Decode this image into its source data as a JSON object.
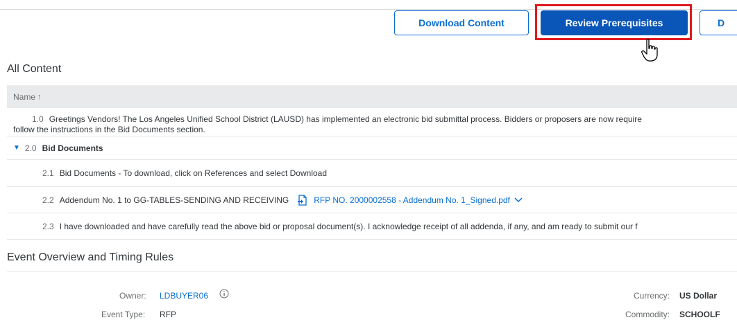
{
  "toolbar": {
    "download_label": "Download Content",
    "review_label": "Review Prerequisites",
    "partial_label": "D"
  },
  "all_content": {
    "title": "All Content",
    "header_name": "Name",
    "sort_indicator": "↑",
    "rows": [
      {
        "num": "1.0",
        "text": "Greetings Vendors! The Los Angeles Unified School District (LAUSD) has implemented an electronic bid submittal process. Bidders or proposers are now require",
        "text2": "follow the instructions in the Bid Documents section."
      },
      {
        "num": "2.0",
        "text": "Bid Documents"
      },
      {
        "num": "2.1",
        "text": "Bid Documents - To download, click on References and select Download"
      },
      {
        "num": "2.2",
        "text": "Addendum No. 1 to GG-TABLES-SENDING AND RECEIVING",
        "link": "RFP NO. 2000002558 - Addendum No. 1_Signed.pdf"
      },
      {
        "num": "2.3",
        "text": "I have downloaded and have carefully read the above bid or proposal document(s). I acknowledge receipt of all addenda, if any, and am ready to submit our f"
      }
    ]
  },
  "event_overview": {
    "title": "Event Overview and Timing Rules",
    "owner_label": "Owner:",
    "owner_value": "LDBUYER06",
    "event_type_label": "Event Type:",
    "event_type_value": "RFP",
    "currency_label": "Currency:",
    "currency_value": "US Dollar",
    "commodity_label": "Commodity:",
    "commodity_value": "SCHOOLF"
  },
  "colors": {
    "accent": "#0a6ed1",
    "primary_button": "#0a56b8",
    "highlight": "#e0191f"
  },
  "icons": [
    "pointer-cursor-icon",
    "document-icon",
    "chevron-down-icon",
    "info-icon",
    "expand-arrow-icon",
    "sort-up-icon"
  ]
}
